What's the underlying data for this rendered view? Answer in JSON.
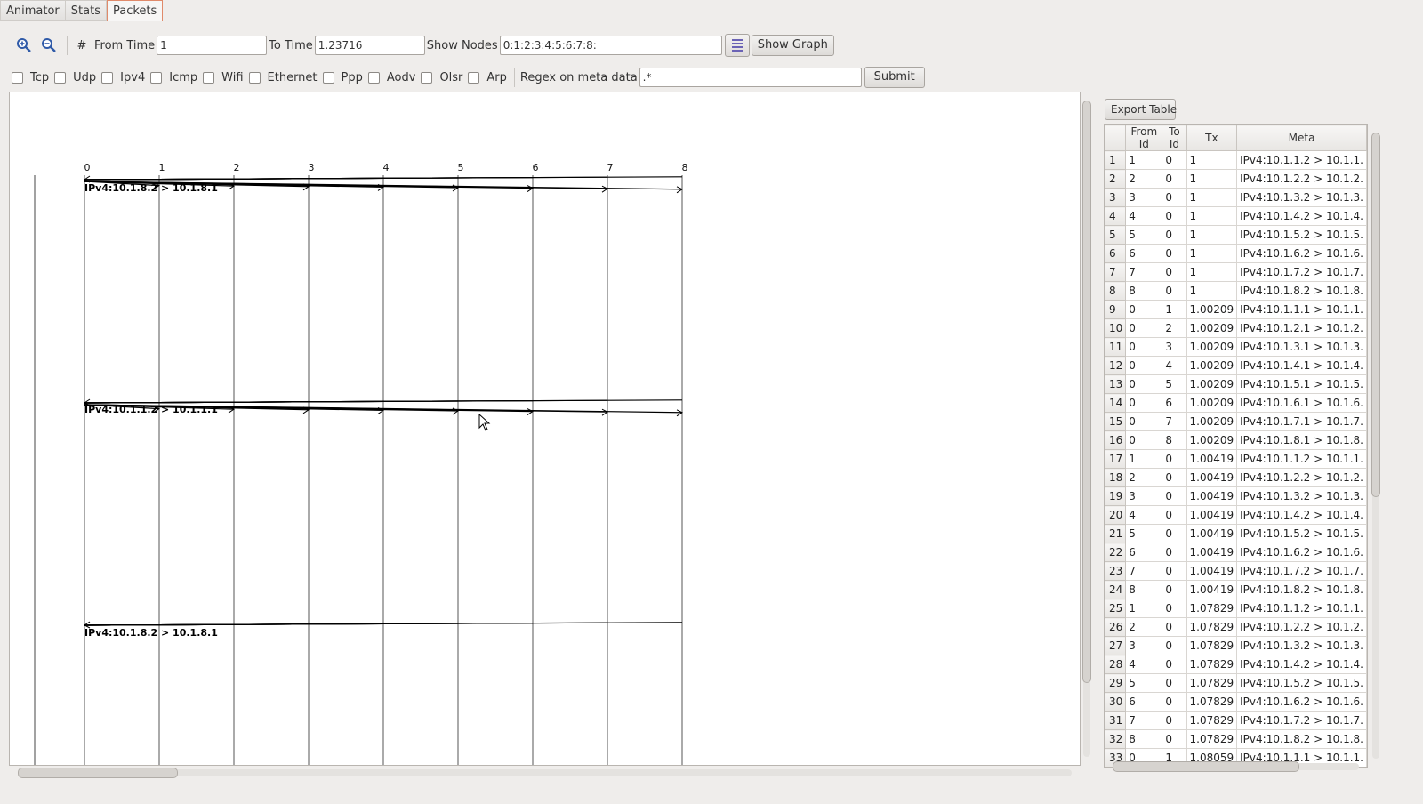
{
  "tabs": [
    {
      "label": "Animator",
      "active": false
    },
    {
      "label": "Stats",
      "active": false
    },
    {
      "label": "Packets",
      "active": true
    }
  ],
  "toolbar": {
    "hash_symbol": "#",
    "from_time_label": "From Time",
    "from_time_value": "1",
    "to_time_label": "To Time",
    "to_time_value": "1.23716",
    "show_nodes_label": "Show Nodes",
    "show_nodes_value": "0:1:2:3:4:5:6:7:8:",
    "show_graph_label": "Show Graph"
  },
  "filters": {
    "protocols": [
      "Tcp",
      "Udp",
      "Ipv4",
      "Icmp",
      "Wifi",
      "Ethernet",
      "Ppp",
      "Aodv",
      "Olsr",
      "Arp"
    ],
    "regex_label": "Regex on meta data",
    "regex_value": ".*",
    "submit_label": "Submit"
  },
  "graph": {
    "nodes": [
      "0",
      "1",
      "2",
      "3",
      "4",
      "5",
      "6",
      "7",
      "8"
    ],
    "labels": [
      "IPv4:10.1.8.2 > 10.1.8.1",
      "IPv4:10.1.1.2 > 10.1.1.1",
      "IPv4:10.1.8.2 > 10.1.8.1"
    ]
  },
  "table": {
    "export_label": "Export Table",
    "columns": [
      "From Id",
      "To Id",
      "Tx",
      "Meta"
    ],
    "rows": [
      [
        "1",
        "1",
        "0",
        "1",
        "IPv4:10.1.1.2 > 10.1.1."
      ],
      [
        "2",
        "2",
        "0",
        "1",
        "IPv4:10.1.2.2 > 10.1.2."
      ],
      [
        "3",
        "3",
        "0",
        "1",
        "IPv4:10.1.3.2 > 10.1.3."
      ],
      [
        "4",
        "4",
        "0",
        "1",
        "IPv4:10.1.4.2 > 10.1.4."
      ],
      [
        "5",
        "5",
        "0",
        "1",
        "IPv4:10.1.5.2 > 10.1.5."
      ],
      [
        "6",
        "6",
        "0",
        "1",
        "IPv4:10.1.6.2 > 10.1.6."
      ],
      [
        "7",
        "7",
        "0",
        "1",
        "IPv4:10.1.7.2 > 10.1.7."
      ],
      [
        "8",
        "8",
        "0",
        "1",
        "IPv4:10.1.8.2 > 10.1.8."
      ],
      [
        "9",
        "0",
        "1",
        "1.00209",
        "IPv4:10.1.1.1 > 10.1.1."
      ],
      [
        "10",
        "0",
        "2",
        "1.00209",
        "IPv4:10.1.2.1 > 10.1.2."
      ],
      [
        "11",
        "0",
        "3",
        "1.00209",
        "IPv4:10.1.3.1 > 10.1.3."
      ],
      [
        "12",
        "0",
        "4",
        "1.00209",
        "IPv4:10.1.4.1 > 10.1.4."
      ],
      [
        "13",
        "0",
        "5",
        "1.00209",
        "IPv4:10.1.5.1 > 10.1.5."
      ],
      [
        "14",
        "0",
        "6",
        "1.00209",
        "IPv4:10.1.6.1 > 10.1.6."
      ],
      [
        "15",
        "0",
        "7",
        "1.00209",
        "IPv4:10.1.7.1 > 10.1.7."
      ],
      [
        "16",
        "0",
        "8",
        "1.00209",
        "IPv4:10.1.8.1 > 10.1.8."
      ],
      [
        "17",
        "1",
        "0",
        "1.00419",
        "IPv4:10.1.1.2 > 10.1.1."
      ],
      [
        "18",
        "2",
        "0",
        "1.00419",
        "IPv4:10.1.2.2 > 10.1.2."
      ],
      [
        "19",
        "3",
        "0",
        "1.00419",
        "IPv4:10.1.3.2 > 10.1.3."
      ],
      [
        "20",
        "4",
        "0",
        "1.00419",
        "IPv4:10.1.4.2 > 10.1.4."
      ],
      [
        "21",
        "5",
        "0",
        "1.00419",
        "IPv4:10.1.5.2 > 10.1.5."
      ],
      [
        "22",
        "6",
        "0",
        "1.00419",
        "IPv4:10.1.6.2 > 10.1.6."
      ],
      [
        "23",
        "7",
        "0",
        "1.00419",
        "IPv4:10.1.7.2 > 10.1.7."
      ],
      [
        "24",
        "8",
        "0",
        "1.00419",
        "IPv4:10.1.8.2 > 10.1.8."
      ],
      [
        "25",
        "1",
        "0",
        "1.07829",
        "IPv4:10.1.1.2 > 10.1.1."
      ],
      [
        "26",
        "2",
        "0",
        "1.07829",
        "IPv4:10.1.2.2 > 10.1.2."
      ],
      [
        "27",
        "3",
        "0",
        "1.07829",
        "IPv4:10.1.3.2 > 10.1.3."
      ],
      [
        "28",
        "4",
        "0",
        "1.07829",
        "IPv4:10.1.4.2 > 10.1.4."
      ],
      [
        "29",
        "5",
        "0",
        "1.07829",
        "IPv4:10.1.5.2 > 10.1.5."
      ],
      [
        "30",
        "6",
        "0",
        "1.07829",
        "IPv4:10.1.6.2 > 10.1.6."
      ],
      [
        "31",
        "7",
        "0",
        "1.07829",
        "IPv4:10.1.7.2 > 10.1.7."
      ],
      [
        "32",
        "8",
        "0",
        "1.07829",
        "IPv4:10.1.8.2 > 10.1.8."
      ],
      [
        "33",
        "0",
        "1",
        "1.08059",
        "IPv4:10.1.1.1 > 10.1.1."
      ]
    ]
  },
  "colors": {
    "active_tab_border": "#e08a6a",
    "graph_button": "#6b63b5"
  }
}
